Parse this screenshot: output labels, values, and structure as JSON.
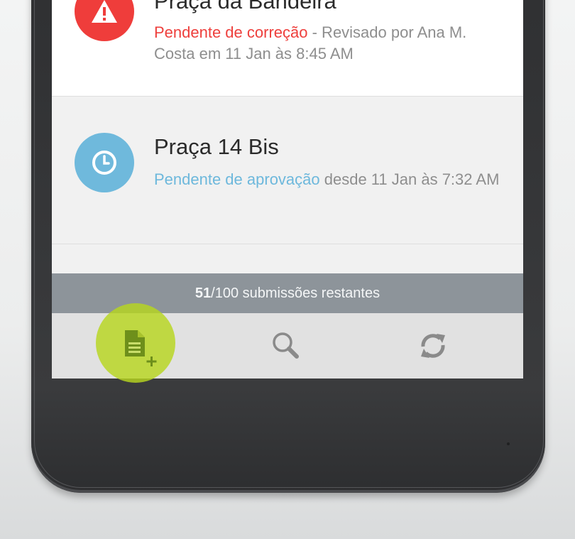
{
  "list": {
    "items": [
      {
        "title": "Praça da Bandeira",
        "status": "Pendente de correção",
        "detail": " - Revisado por Ana M. Costa em 11 Jan às 8:45 AM",
        "icon": "warning-icon",
        "status_color": "#ee3f3c",
        "icon_color": "#ef3d3b"
      },
      {
        "title": "Praça 14 Bis",
        "status": "Pendente de aprovação",
        "detail": " desde 11 Jan às 7:32 AM",
        "icon": "clock-icon",
        "status_color": "#6db8dc",
        "icon_color": "#6fb9dc"
      }
    ]
  },
  "counter": {
    "used": "51",
    "text": "/100 submissões restantes"
  },
  "nav": {
    "new_icon": "new-document-icon",
    "search_icon": "search-icon",
    "sync_icon": "sync-icon",
    "highlight_color": "#b7d61e"
  }
}
